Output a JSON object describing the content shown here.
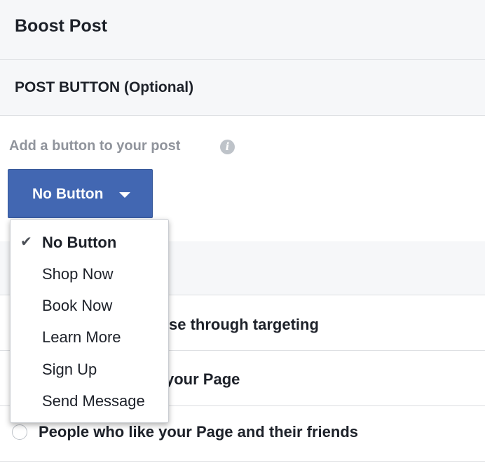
{
  "header": {
    "title": "Boost Post"
  },
  "section": {
    "label": "POST BUTTON (Optional)"
  },
  "add_button": {
    "label": "Add a button to your post",
    "info_icon": "info-icon"
  },
  "primary_button": {
    "label": "No Button",
    "caret_icon": "caret-down-icon",
    "color": "#4267b2"
  },
  "dropdown": {
    "items": [
      {
        "label": "No Button",
        "selected": true
      },
      {
        "label": "Shop Now",
        "selected": false
      },
      {
        "label": "Book Now",
        "selected": false
      },
      {
        "label": "Learn More",
        "selected": false
      },
      {
        "label": "Sign Up",
        "selected": false
      },
      {
        "label": "Send Message",
        "selected": false
      }
    ]
  },
  "audience_rows": [
    {
      "text_visible": "se through targeting"
    },
    {
      "text_visible": "your Page"
    },
    {
      "text_visible": "People who like your Page and their friends"
    }
  ]
}
